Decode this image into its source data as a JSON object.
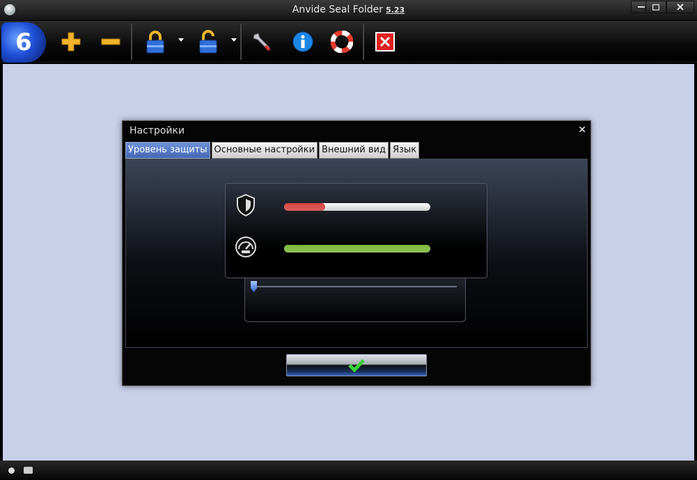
{
  "window": {
    "title": "Anvide Seal Folder",
    "version": "5.23",
    "controls": [
      "minimize",
      "maximize",
      "close"
    ]
  },
  "toolbar": {
    "logo_label": "6",
    "buttons": [
      {
        "name": "add-folder-icon"
      },
      {
        "name": "remove-folder-icon"
      },
      {
        "name": "lock-icon",
        "has_dropdown": true
      },
      {
        "name": "unlock-icon",
        "has_dropdown": true
      },
      {
        "name": "settings-tools-icon"
      },
      {
        "name": "info-icon"
      },
      {
        "name": "help-lifebuoy-icon"
      },
      {
        "name": "exit-icon"
      }
    ]
  },
  "dialog": {
    "title": "Настройки",
    "close_glyph": "✕",
    "tabs": [
      {
        "label": "Уровень защиты",
        "active": true
      },
      {
        "label": "Основные настройки",
        "active": false
      },
      {
        "label": "Внешний вид",
        "active": false
      },
      {
        "label": "Язык",
        "active": false
      }
    ],
    "meters": [
      {
        "icon": "shield-icon",
        "fraction": 0.28,
        "color": "#d9413f"
      },
      {
        "icon": "speedometer-icon",
        "fraction": 1.0,
        "color": "#7cb93a"
      }
    ],
    "slider": {
      "position": 0.0
    },
    "ok_icon": "checkmark-icon"
  },
  "colors": {
    "workspace": "#c8cfe9",
    "active_tab": "#5577c4",
    "accent_blue": "#3163d2"
  }
}
